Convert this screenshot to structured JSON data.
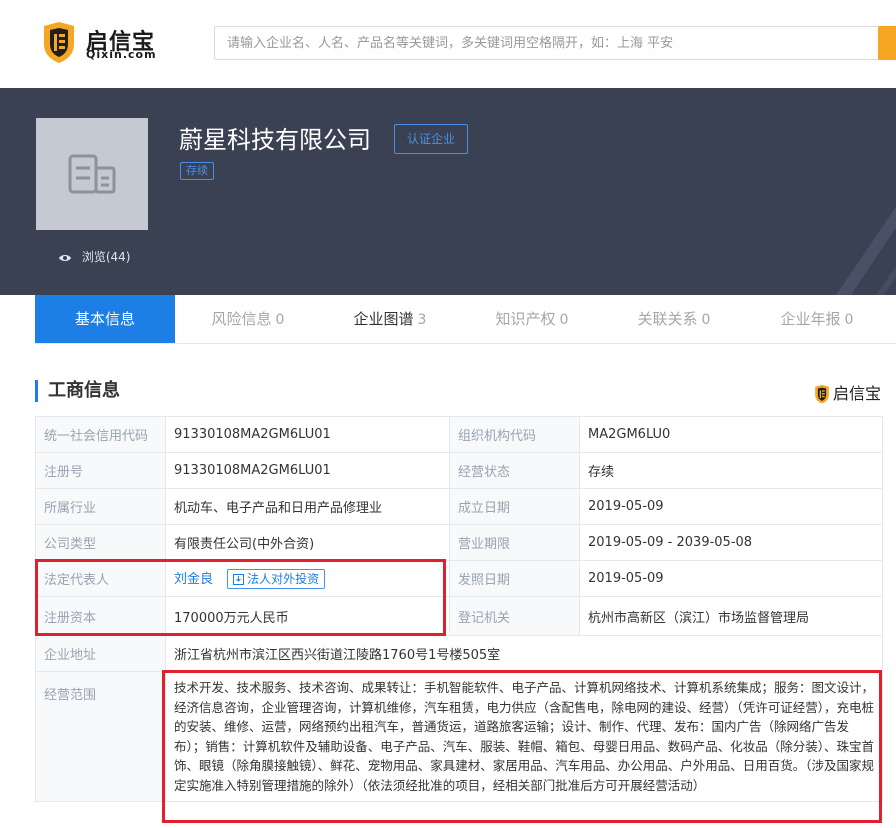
{
  "brand": {
    "name_cn": "启信宝",
    "name_en": "Qixin.com",
    "icon": "qixin-logo-icon"
  },
  "search": {
    "placeholder": "请输入企业名、人名、产品名等关键词，多关键词用空格隔开，如：上海 平安"
  },
  "company": {
    "name": "蔚星科技有限公司",
    "verify_badge": "认证企业",
    "status_tag": "存续",
    "views_label": "浏览(44)"
  },
  "tabs": [
    {
      "label": "基本信息",
      "count": ""
    },
    {
      "label": "风险信息",
      "count": "0"
    },
    {
      "label": "企业图谱",
      "count": "3"
    },
    {
      "label": "知识产权",
      "count": "0"
    },
    {
      "label": "关联关系",
      "count": "0"
    },
    {
      "label": "企业年报",
      "count": "0"
    }
  ],
  "section": {
    "title": "工商信息",
    "brand_mark": "启信宝"
  },
  "info": {
    "credit_code_label": "统一社会信用代码",
    "credit_code": "91330108MA2GM6LU01",
    "org_code_label": "组织机构代码",
    "org_code": "MA2GM6LU0",
    "reg_no_label": "注册号",
    "reg_no": "91330108MA2GM6LU01",
    "op_status_label": "经营状态",
    "op_status": "存续",
    "industry_label": "所属行业",
    "industry": "机动车、电子产品和日用产品修理业",
    "founded_label": "成立日期",
    "founded": "2019-05-09",
    "company_type_label": "公司类型",
    "company_type": "有限责任公司(中外合资)",
    "term_label": "营业期限",
    "term": "2019-05-09 - 2039-05-08",
    "legal_rep_label": "法定代表人",
    "legal_rep": "刘金良",
    "invest_button": "法人对外投资",
    "license_date_label": "发照日期",
    "license_date": "2019-05-09",
    "capital_label": "注册资本",
    "capital": "170000万元人民币",
    "authority_label": "登记机关",
    "authority": "杭州市高新区（滨江）市场监督管理局",
    "address_label": "企业地址",
    "address": "浙江省杭州市滨江区西兴街道江陵路1760号1号楼505室",
    "scope_label": "经营范围",
    "scope": "技术开发、技术服务、技术咨询、成果转让：手机智能软件、电子产品、计算机网络技术、计算机系统集成；服务：图文设计，经济信息咨询，企业管理咨询，计算机维修，汽车租赁，电力供应（含配售电，除电网的建设、经营）（凭许可证经营），充电桩的安装、维修、运营，网络预约出租汽车，普通货运，道路旅客运输；设计、制作、代理、发布：国内广告（除网络广告发布）；销售：计算机软件及辅助设备、电子产品、汽车、服装、鞋帽、箱包、母婴日用品、数码产品、化妆品（除分装）、珠宝首饰、眼镜（除角膜接触镜）、鲜花、宠物用品、家具建材、家居用品、汽车用品、办公用品、户外用品、日用百货。（涉及国家规定实施准入特别管理措施的除外）（依法须经批准的项目，经相关部门批准后方可开展经营活动）"
  },
  "colors": {
    "accent": "#1d7ee6",
    "hero_bg": "#3a4153",
    "highlight": "#e0202e",
    "search_button": "#f5a623"
  }
}
